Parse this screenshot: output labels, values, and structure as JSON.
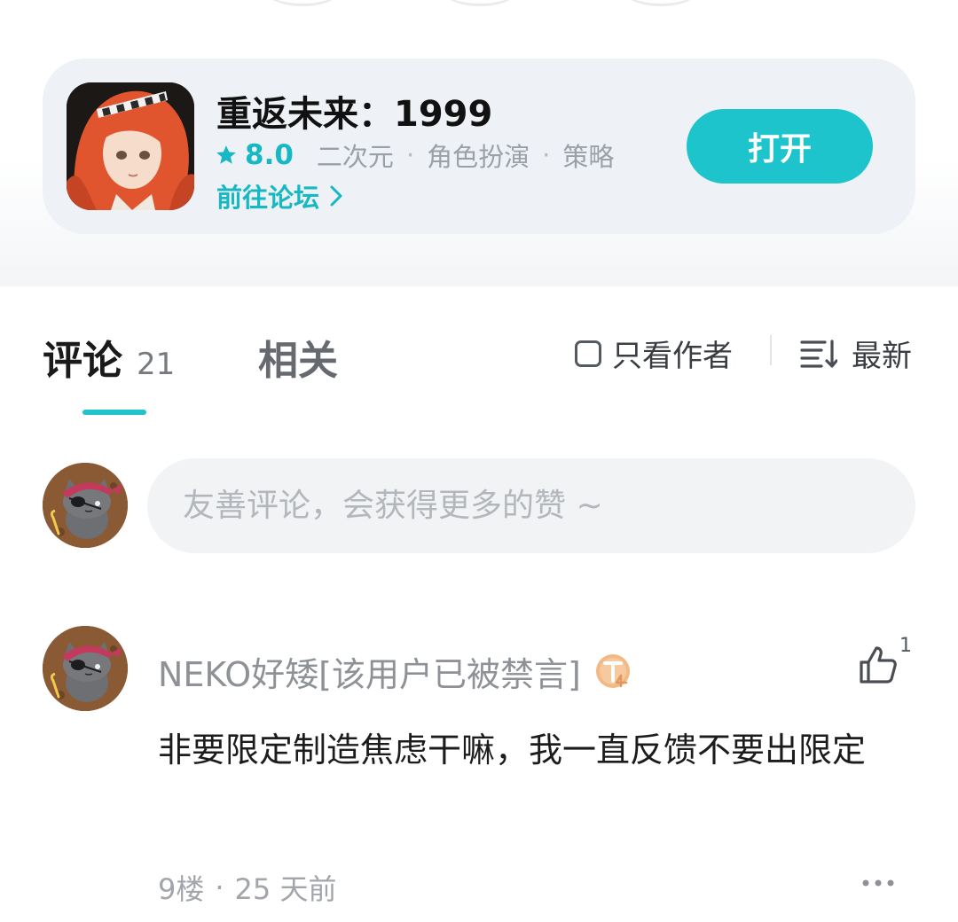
{
  "app_card": {
    "title": "重返未来：1999",
    "rating": "8.0",
    "tags": [
      "二次元",
      "角色扮演",
      "策略"
    ],
    "forum_link": "前往论坛",
    "open_button": "打开",
    "accent_color": "#17b8c4"
  },
  "tabs": {
    "comments_label": "评论",
    "comments_count": "21",
    "related_label": "相关",
    "author_only_label": "只看作者",
    "sort_label": "最新"
  },
  "composer": {
    "placeholder": "友善评论，会获得更多的赞 ~"
  },
  "comment": {
    "username": "NEKO好矮[该用户已被禁言]",
    "level_badge": "T4",
    "text": "非要限定制造焦虑干嘛，我一直反馈不要出限定",
    "like_count": "1",
    "floor": "9楼",
    "time": "25 天前"
  },
  "icons": {
    "rating": "star-icon",
    "forum": "chevron-right-icon",
    "filter": "checkbox-icon",
    "sort": "sort-lines-icon",
    "like": "thumbs-up-icon",
    "more": "more-horizontal-icon"
  }
}
